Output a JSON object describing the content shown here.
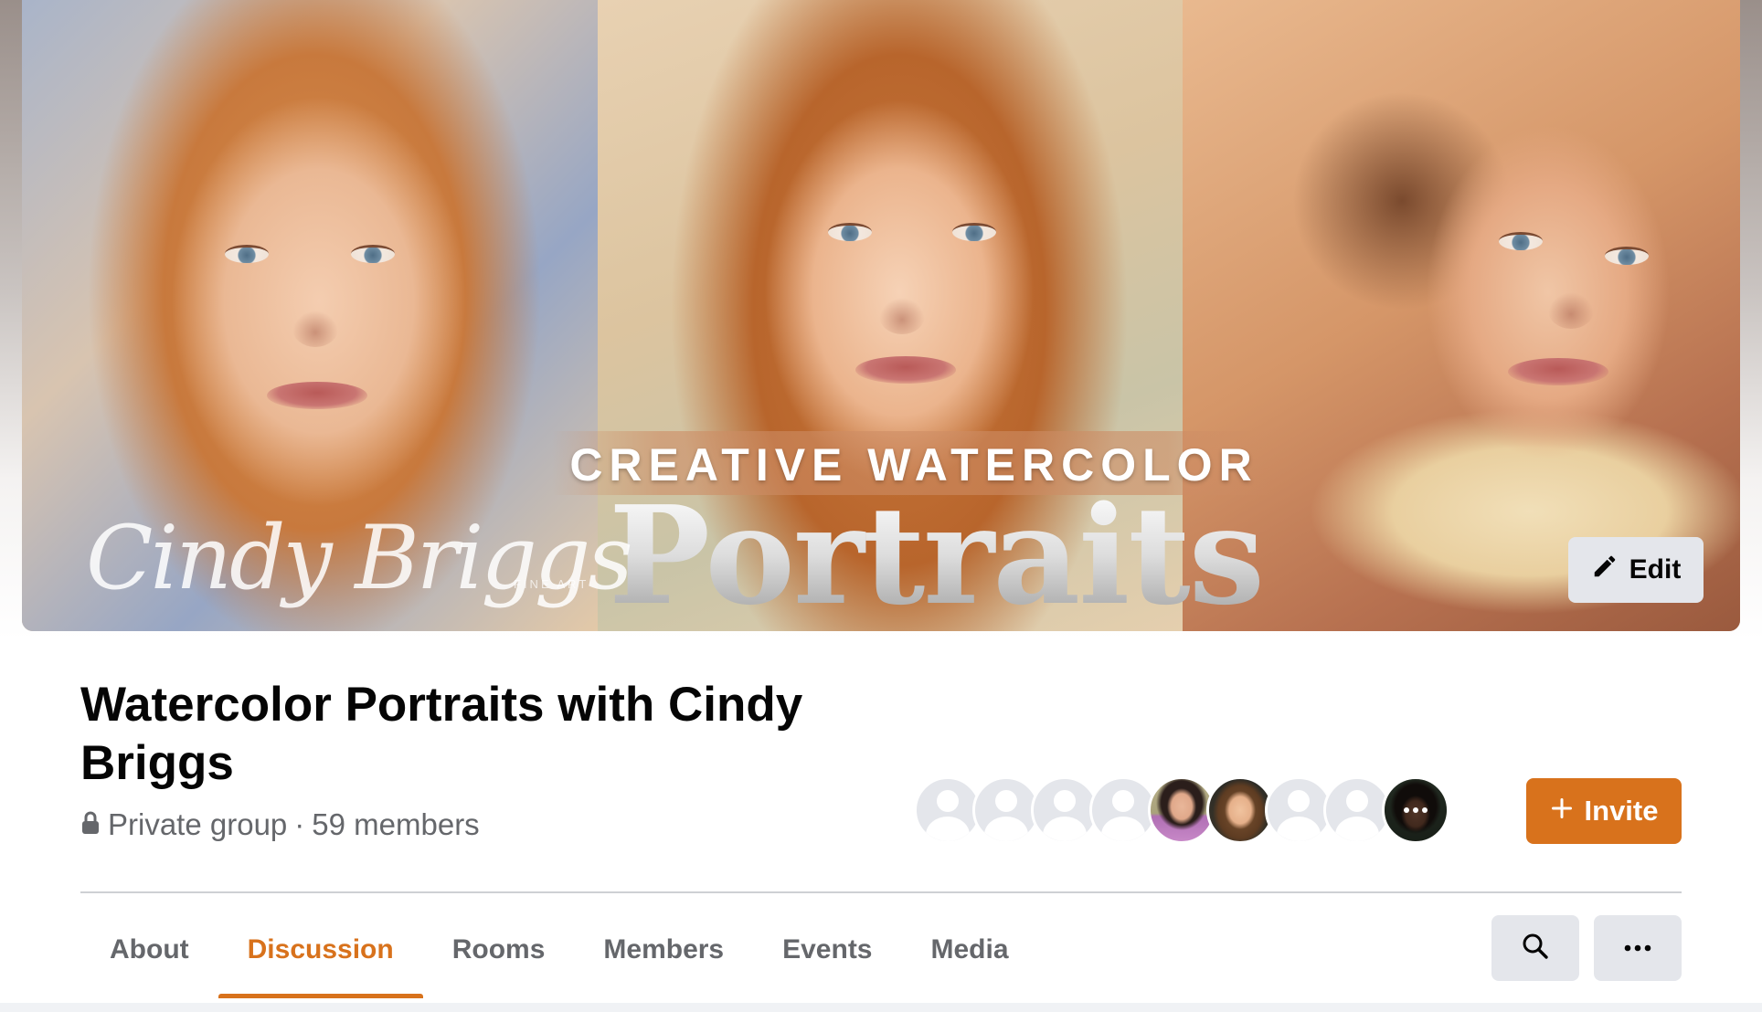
{
  "cover": {
    "title_top": "CREATIVE WATERCOLOR",
    "title_main": "Portraits",
    "signature": "Cindy Briggs",
    "signature_sub": "FINE ART",
    "edit_label": "Edit"
  },
  "group": {
    "name": "Watercolor Portraits with Cindy Briggs",
    "privacy": "Private group",
    "separator": "·",
    "members": "59 members"
  },
  "invite_label": "Invite",
  "tabs": [
    {
      "label": "About",
      "active": false
    },
    {
      "label": "Discussion",
      "active": true
    },
    {
      "label": "Rooms",
      "active": false
    },
    {
      "label": "Members",
      "active": false
    },
    {
      "label": "Events",
      "active": false
    },
    {
      "label": "Media",
      "active": false
    }
  ],
  "icons": {
    "edit": "pencil-icon",
    "lock": "lock-icon",
    "invite": "plus-icon",
    "search": "search-icon",
    "more": "more-horizontal-icon"
  },
  "colors": {
    "accent": "#d8721c",
    "button_gray": "#e4e6eb",
    "text_primary": "#050505",
    "text_secondary": "#65676b"
  }
}
